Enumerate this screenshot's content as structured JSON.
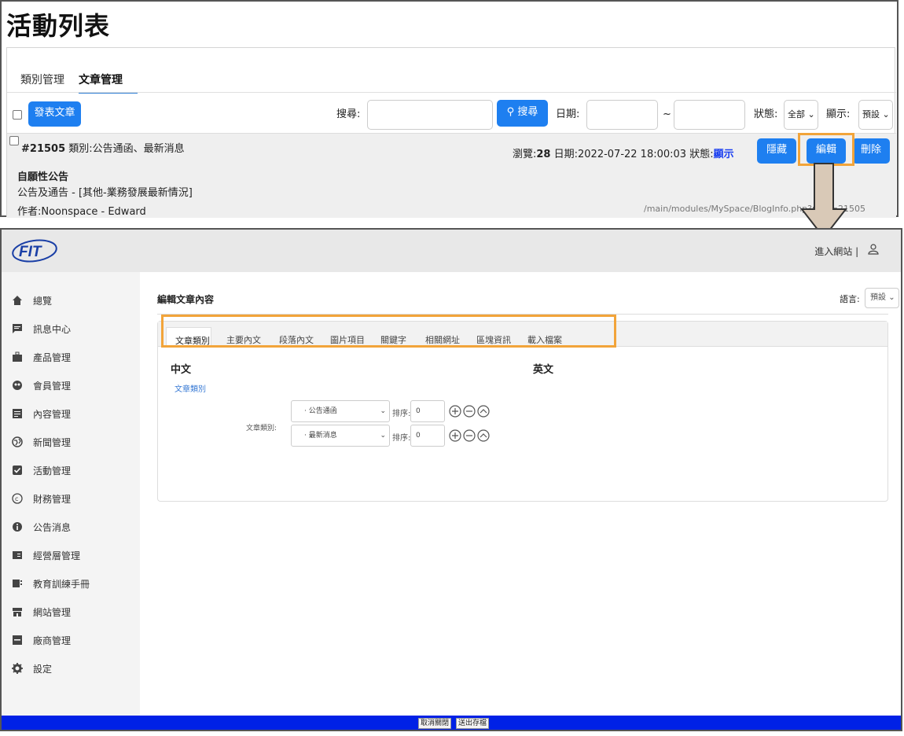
{
  "list_page": {
    "title": "活動列表",
    "tabs": [
      "類別管理",
      "文章管理"
    ],
    "publish_button": "發表文章",
    "search_label": "搜尋:",
    "search_button": "搜尋",
    "date_label": "日期:",
    "date_sep": "~",
    "status_label": "狀態:",
    "status_value": "全部",
    "display_label": "顯示:",
    "display_value": "預設",
    "post": {
      "id": "#21505",
      "category": "類別:公告通函、最新消息",
      "views_label": "瀏覽:",
      "views": "28",
      "date": "日期:2022-07-22 18:00:03",
      "status_label": "狀態:",
      "status_value": "顯示",
      "title": "自願性公告",
      "subtitle": "公告及通告 - [其他-業務發展最新情況]",
      "author": "作者:Noonspace - Edward",
      "url": "/main/modules/MySpace/BlogInfo.php?mlid=21505"
    },
    "actions": {
      "hide": "隱藏",
      "edit": "編輯",
      "delete": "刪除"
    }
  },
  "edit_page": {
    "logo_text": "FIT",
    "header_link": "進入網站",
    "header_sep": "|",
    "sidebar": [
      {
        "label": "總覽",
        "icon": "home-icon"
      },
      {
        "label": "訊息中心",
        "icon": "chat-icon"
      },
      {
        "label": "產品管理",
        "icon": "briefcase-icon"
      },
      {
        "label": "會員管理",
        "icon": "members-icon"
      },
      {
        "label": "內容管理",
        "icon": "document-icon"
      },
      {
        "label": "新聞管理",
        "icon": "globe-icon"
      },
      {
        "label": "活動管理",
        "icon": "checkbox-icon"
      },
      {
        "label": "財務管理",
        "icon": "copyright-icon"
      },
      {
        "label": "公告消息",
        "icon": "info-icon"
      },
      {
        "label": "經營層管理",
        "icon": "card-icon"
      },
      {
        "label": "教育訓練手冊",
        "icon": "book-icon"
      },
      {
        "label": "網站管理",
        "icon": "store-icon"
      },
      {
        "label": "廠商管理",
        "icon": "vendor-icon"
      },
      {
        "label": "設定",
        "icon": "gear-icon"
      }
    ],
    "section_title": "編輯文章內容",
    "language_label": "語言:",
    "language_value": "預設",
    "tabs": [
      "文章類別",
      "主要內文",
      "段落內文",
      "圖片項目",
      "關鍵字",
      "相關網址",
      "區塊資訊",
      "載入檔案"
    ],
    "col_zh": "中文",
    "col_en": "英文",
    "sub_link": "文章類別",
    "field_label": "文章類別:",
    "rows": [
      {
        "category": "· 公告通函",
        "sort_label": "排序:",
        "sort_value": "0"
      },
      {
        "category": "· 最新消息",
        "sort_label": "排序:",
        "sort_value": "0"
      }
    ],
    "footer": {
      "cancel": "取消關閉",
      "save": "送出存檔"
    }
  }
}
